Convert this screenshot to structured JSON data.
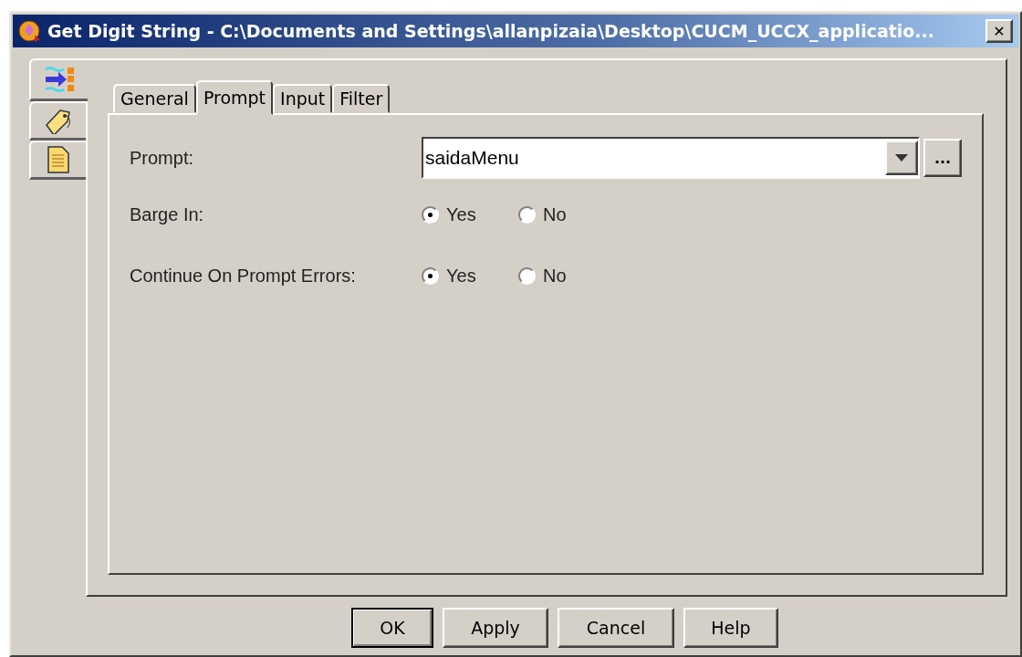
{
  "window": {
    "title": "Get Digit String - C:\\Documents and Settings\\allanpizaia\\Desktop\\CUCM_UCCX_applicatio...",
    "close": "✕"
  },
  "side_tabs": [
    {
      "kind": "flow",
      "selected": true
    },
    {
      "kind": "tag",
      "selected": false
    },
    {
      "kind": "notes",
      "selected": false
    }
  ],
  "tabs": [
    {
      "label": "General",
      "selected": false
    },
    {
      "label": "Prompt",
      "selected": true
    },
    {
      "label": "Input",
      "selected": false
    },
    {
      "label": "Filter",
      "selected": false
    }
  ],
  "prompt": {
    "label": "Prompt:",
    "value": "saidaMenu",
    "browse": "..."
  },
  "options": [
    {
      "label": "Barge In:",
      "choices": [
        {
          "label": "Yes",
          "selected": true
        },
        {
          "label": "No",
          "selected": false
        }
      ]
    },
    {
      "label": "Continue On Prompt Errors:",
      "choices": [
        {
          "label": "Yes",
          "selected": true
        },
        {
          "label": "No",
          "selected": false
        }
      ]
    }
  ],
  "buttons": [
    {
      "label": "OK",
      "default": true
    },
    {
      "label": "Apply",
      "default": false
    },
    {
      "label": "Cancel",
      "default": false
    },
    {
      "label": "Help",
      "default": false
    }
  ]
}
